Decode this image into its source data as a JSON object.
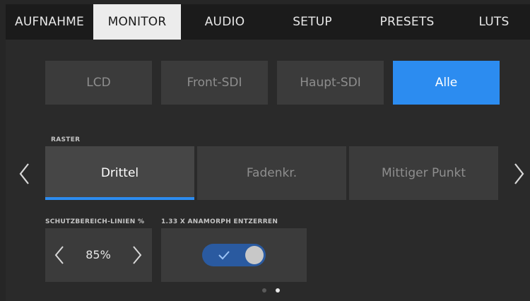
{
  "tabs": [
    {
      "label": "AUFNAHME",
      "active": false
    },
    {
      "label": "MONITOR",
      "active": true
    },
    {
      "label": "AUDIO",
      "active": false
    },
    {
      "label": "SETUP",
      "active": false
    },
    {
      "label": "PRESETS",
      "active": false
    },
    {
      "label": "LUTS",
      "active": false
    }
  ],
  "outputs": [
    {
      "label": "LCD",
      "selected": false
    },
    {
      "label": "Front-SDI",
      "selected": false
    },
    {
      "label": "Haupt-SDI",
      "selected": false
    },
    {
      "label": "Alle",
      "selected": true
    }
  ],
  "raster": {
    "label": "RASTER",
    "options": [
      {
        "label": "Drittel",
        "selected": true
      },
      {
        "label": "Fadenkr.",
        "selected": false
      },
      {
        "label": "Mittiger Punkt",
        "selected": false
      }
    ],
    "prev_icon": "chevron-left-icon",
    "next_icon": "chevron-right-icon"
  },
  "safe_area": {
    "label": "SCHUTZBEREICH-LINIEN %",
    "value": "85%"
  },
  "anamorphic": {
    "label": "1.33 x ANAMORPH ENTZERREN",
    "enabled": true,
    "icon": "checkmark-icon"
  },
  "pagination": {
    "total": 2,
    "current": 2
  },
  "colors": {
    "accent": "#2c8cf0",
    "toggle_on": "#2a5aa0",
    "tab_active_bg": "#ececec"
  }
}
